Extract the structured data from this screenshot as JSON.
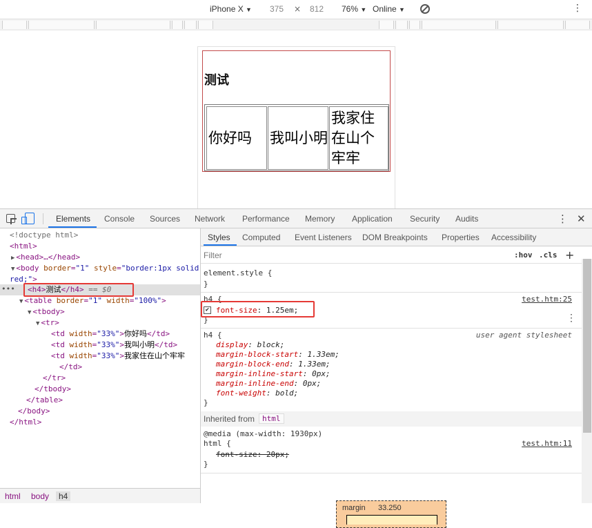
{
  "device_toolbar": {
    "device": "iPhone X",
    "width": "375",
    "times": "×",
    "height": "812",
    "zoom": "76%",
    "network": "Online",
    "caret": "▼"
  },
  "page": {
    "heading": "测试",
    "cells": [
      "你好吗",
      "我叫小明",
      "我家住在山个牢牢"
    ]
  },
  "devtools": {
    "tabs": [
      "Elements",
      "Console",
      "Sources",
      "Network",
      "Performance",
      "Memory",
      "Application",
      "Security",
      "Audits"
    ],
    "dom": {
      "doctype": "<!doctype html>",
      "html_open": "<html>",
      "head": "<head>…</head>",
      "body_open_a": "<body ",
      "body_attr1": "border",
      "body_val1": "\"1\"",
      "body_attr2": "style",
      "body_val2a": "\"border:1px solid",
      "body_val2b": "red;\"",
      "body_close_bracket": ">",
      "h4_open": "<h4>",
      "h4_text": "测试",
      "h4_close": "</h4>",
      "h4_eq": "== $0",
      "table_open": "<table ",
      "table_attr1": "border",
      "table_val1": "\"1\"",
      "table_attr2": "width",
      "table_val2": "\"100%\"",
      "tbody_open": "<tbody>",
      "tr_open": "<tr>",
      "td_open": "<td ",
      "td_attr": "width",
      "td_val": "\"33%\"",
      "td_close": "</td>",
      "td_texts": [
        "你好吗",
        "我叫小明",
        "我家住在山个牢牢"
      ],
      "tr_close": "</tr>",
      "tbody_close": "</tbody>",
      "table_close": "</table>",
      "body_close": "</body>",
      "html_close": "</html>"
    },
    "breadcrumbs": [
      "html",
      "body",
      "h4"
    ],
    "styles_tabs": [
      "Styles",
      "Computed",
      "Event Listeners",
      "DOM Breakpoints",
      "Properties",
      "Accessibility"
    ],
    "filter_placeholder": "Filter",
    "hov": ":hov",
    "cls": ".cls",
    "plus": "+",
    "rules": {
      "element_style": "element.style {",
      "close": "}",
      "h4_selector": "h4 {",
      "h4_source": "test.htm:25",
      "h4_prop": "font-size",
      "h4_val": "1.25em;",
      "ua_selector": "h4 {",
      "ua_source": "user agent stylesheet",
      "ua_props": [
        {
          "p": "display",
          "v": "block;"
        },
        {
          "p": "margin-block-start",
          "v": "1.33em;"
        },
        {
          "p": "margin-block-end",
          "v": "1.33em;"
        },
        {
          "p": "margin-inline-start",
          "v": "0px;"
        },
        {
          "p": "margin-inline-end",
          "v": "0px;"
        },
        {
          "p": "font-weight",
          "v": "bold;"
        }
      ],
      "inherited_label": "Inherited from",
      "inherited_tag": "html",
      "media": "@media (max-width: 1930px)",
      "html_selector": "html {",
      "html_source": "test.htm:11",
      "html_prop": "font-size: 20px;"
    },
    "box_model": {
      "label": "margin",
      "value": "33.250"
    }
  }
}
